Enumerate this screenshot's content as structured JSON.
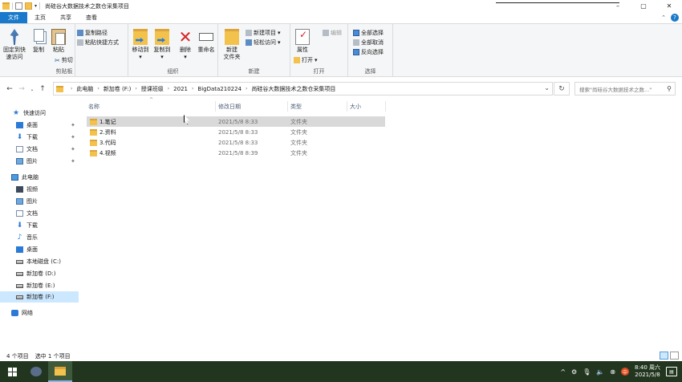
{
  "window": {
    "title": "尚硅谷大数据技术之数仓采集项目",
    "controls": [
      "–",
      "▢",
      "✕"
    ]
  },
  "ribbon_tabs": {
    "file": "文件",
    "home": "主页",
    "share": "共享",
    "view": "查看"
  },
  "ribbon": {
    "clipboard": {
      "pin": "固定到快",
      "pin2": "速访问",
      "copy": "复制",
      "paste": "粘贴",
      "copy_path": "复制路径",
      "paste_shortcut": "粘贴快捷方式",
      "cut": "剪切",
      "label": "剪贴板"
    },
    "organize": {
      "move_to": "移动到",
      "copy_to": "复制到",
      "delete": "删除",
      "rename": "重命名",
      "label": "组织"
    },
    "new": {
      "new_folder": "新建",
      "new_folder2": "文件夹",
      "new_item": "新建项目",
      "easy_access": "轻松访问",
      "label": "新建"
    },
    "open": {
      "properties": "属性",
      "open": "打开",
      "edit": "编辑",
      "label": "打开"
    },
    "select": {
      "select_all": "全部选择",
      "select_none": "全部取消",
      "invert": "反向选择",
      "label": "选择"
    }
  },
  "address": {
    "crumbs": [
      "此电脑",
      "新加卷 (F:)",
      "授课班级",
      "2021",
      "BigData210224",
      "尚硅谷大数据技术之数仓采集项目"
    ],
    "search_placeholder": "搜索\"尚硅谷大数据技术之数...\""
  },
  "nav_pane": {
    "quick_access": "快速访问",
    "qa_items": [
      "桌面",
      "下载",
      "文档",
      "图片"
    ],
    "this_pc": "此电脑",
    "pc_items": [
      "视频",
      "图片",
      "文档",
      "下载",
      "音乐",
      "桌面",
      "本地磁盘 (C:)",
      "新加卷 (D:)",
      "新加卷 (E:)",
      "新加卷 (F:)"
    ],
    "network": "网络"
  },
  "columns": {
    "name": "名称",
    "modified": "修改日期",
    "type": "类型",
    "size": "大小"
  },
  "files": [
    {
      "name": "1.笔记",
      "modified": "2021/5/8 8:33",
      "type": "文件夹",
      "size": ""
    },
    {
      "name": "2.资料",
      "modified": "2021/5/8 8:33",
      "type": "文件夹",
      "size": ""
    },
    {
      "name": "3.代码",
      "modified": "2021/5/8 8:33",
      "type": "文件夹",
      "size": ""
    },
    {
      "name": "4.视频",
      "modified": "2021/5/8 8:39",
      "type": "文件夹",
      "size": ""
    }
  ],
  "status": {
    "count": "4 个项目",
    "selected": "选中 1 个项目"
  },
  "taskbar": {
    "time": "8:40 周六",
    "date": "2021/5/8",
    "input_method": "中"
  }
}
